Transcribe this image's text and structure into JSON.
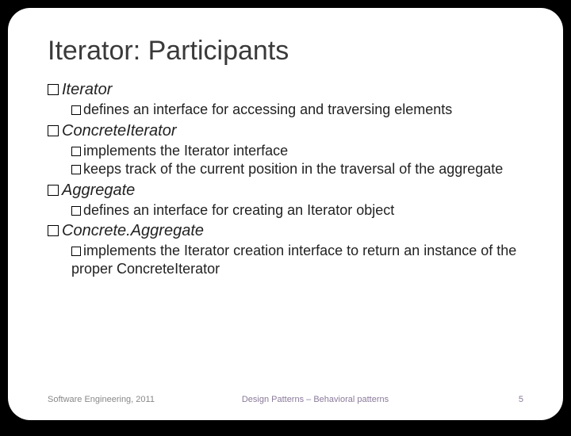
{
  "title": "Iterator: Participants",
  "p1": {
    "name": "Iterator"
  },
  "p1d1": "defines an interface for accessing and traversing elements",
  "p2": {
    "name": "ConcreteIterator"
  },
  "p2d1": "implements the Iterator interface",
  "p2d2": "keeps track of the current position in the traversal of the aggregate",
  "p3": {
    "name": "Aggregate"
  },
  "p3d1": "defines an interface for creating an Iterator object",
  "p4": {
    "name": "Concrete.Aggregate"
  },
  "p4d1": "implements the Iterator creation interface to return an instance of the proper ConcreteIterator",
  "footer": {
    "left": "Software Engineering, 2011",
    "center": "Design Patterns – Behavioral patterns",
    "right": "5"
  }
}
